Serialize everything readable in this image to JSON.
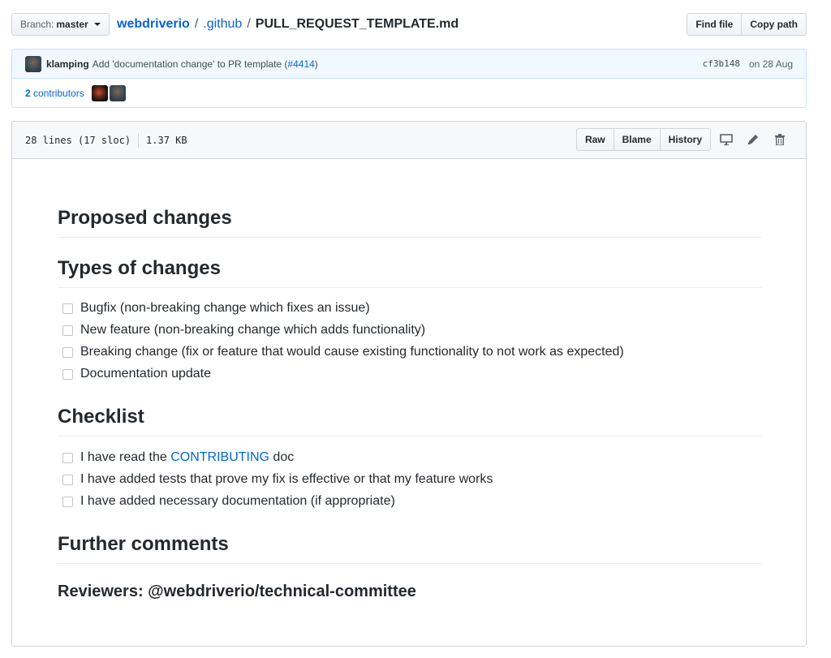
{
  "branch": {
    "label": "Branch:",
    "value": "master"
  },
  "breadcrumb": {
    "repo": "webdriverio",
    "sep1": "/",
    "folder": ".github",
    "sep2": "/",
    "file": "PULL_REQUEST_TEMPLATE.md"
  },
  "file_nav": {
    "find_file": "Find file",
    "copy_path": "Copy path"
  },
  "commit": {
    "author": "klamping",
    "message": "Add 'documentation change' to PR template (",
    "pr_link": "#4414",
    "message_end": ")",
    "sha": "cf3b148",
    "date": "on 28 Aug"
  },
  "contributors": {
    "count": "2",
    "label": "contributors"
  },
  "file_info": {
    "lines": "28 lines (17 sloc)",
    "size": "1.37 KB"
  },
  "file_actions": {
    "raw": "Raw",
    "blame": "Blame",
    "history": "History"
  },
  "content": {
    "h_proposed": "Proposed changes",
    "h_types": "Types of changes",
    "types": [
      "Bugfix (non-breaking change which fixes an issue)",
      "New feature (non-breaking change which adds functionality)",
      "Breaking change (fix or feature that would cause existing functionality to not work as expected)",
      "Documentation update"
    ],
    "h_checklist": "Checklist",
    "checklist_0_pre": "I have read the ",
    "checklist_0_link": "CONTRIBUTING",
    "checklist_0_post": " doc",
    "checklist_1": "I have added tests that prove my fix is effective or that my feature works",
    "checklist_2": "I have added necessary documentation (if appropriate)",
    "h_further": "Further comments",
    "h_reviewers": "Reviewers: @webdriverio/technical-committee"
  }
}
